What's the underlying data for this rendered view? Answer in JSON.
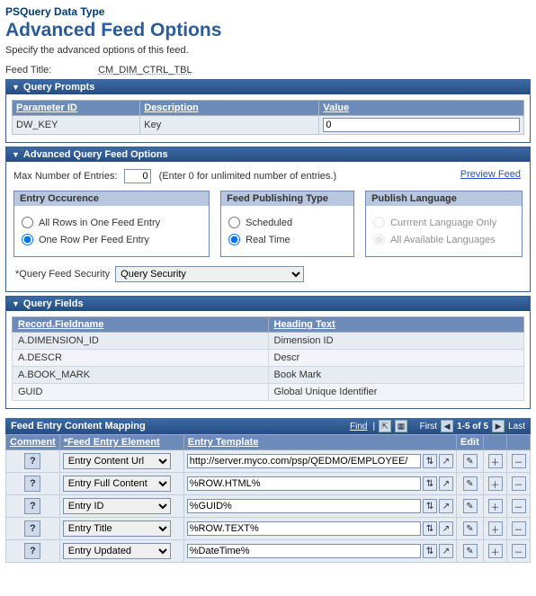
{
  "header": {
    "data_type": "PSQuery Data Type",
    "title": "Advanced Feed Options",
    "desc": "Specify the advanced options of this feed.",
    "feed_title_label": "Feed Title:",
    "feed_title_value": "CM_DIM_CTRL_TBL"
  },
  "prompts": {
    "section_title": "Query Prompts",
    "columns": {
      "param": "Parameter ID",
      "desc": "Description",
      "value": "Value"
    },
    "rows": [
      {
        "param": "DW_KEY",
        "desc": "Key",
        "value": "0"
      }
    ]
  },
  "adv": {
    "section_title": "Advanced Query Feed Options",
    "max_label": "Max Number of Entries:",
    "max_value": "0",
    "max_hint": "(Enter 0 for unlimited number of entries.)",
    "preview": "Preview Feed",
    "entry": {
      "title": "Entry Occurence",
      "opt1": "All Rows in One Feed Entry",
      "opt2": "One Row Per Feed Entry",
      "selected": 2
    },
    "publish": {
      "title": "Feed Publishing Type",
      "opt1": "Scheduled",
      "opt2": "Real Time",
      "selected": 2
    },
    "lang": {
      "title": "Publish Language",
      "opt1": "Currrent Language Only",
      "opt2": "All Available Languages",
      "selected": 2
    },
    "security": {
      "label": "Query Feed Security",
      "value": "Query Security"
    }
  },
  "fields": {
    "section_title": "Query Fields",
    "columns": {
      "rec": "Record.Fieldname",
      "heading": "Heading Text"
    },
    "rows": [
      {
        "rec": "A.DIMENSION_ID",
        "heading": "Dimension ID"
      },
      {
        "rec": "A.DESCR",
        "heading": "Descr"
      },
      {
        "rec": "A.BOOK_MARK",
        "heading": "Book Mark"
      },
      {
        "rec": "GUID",
        "heading": "Global Unique Identifier"
      }
    ]
  },
  "mapping": {
    "title": "Feed Entry Content Mapping",
    "nav": {
      "find": "Find",
      "first": "First",
      "range": "1-5 of 5",
      "last": "Last"
    },
    "columns": {
      "comment": "Comment",
      "element": "*Feed Entry Element",
      "template": "Entry Template",
      "edit": "Edit"
    },
    "rows": [
      {
        "element": "Entry Content Url",
        "template": "http://server.myco.com/psp/QEDMO/EMPLOYEE/"
      },
      {
        "element": "Entry Full Content",
        "template": "%ROW.HTML%"
      },
      {
        "element": "Entry ID",
        "template": "%GUID%"
      },
      {
        "element": "Entry Title",
        "template": "%ROW.TEXT%"
      },
      {
        "element": "Entry Updated",
        "template": "%DateTime%"
      }
    ]
  }
}
